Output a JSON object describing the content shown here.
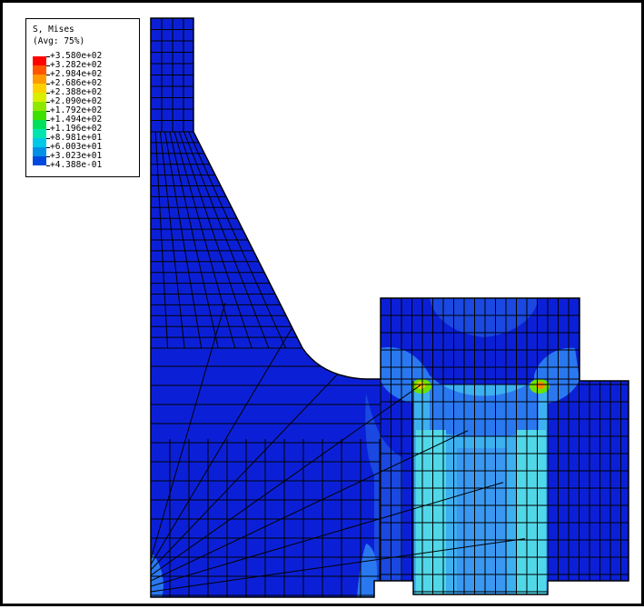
{
  "legend": {
    "variable": "S, Mises",
    "averaging": "(Avg: 75%)",
    "levels": [
      {
        "value": "+3.580e+02",
        "color": "#ff0000"
      },
      {
        "value": "+3.282e+02",
        "color": "#ff5500"
      },
      {
        "value": "+2.984e+02",
        "color": "#ff9a00"
      },
      {
        "value": "+2.686e+02",
        "color": "#ffd000"
      },
      {
        "value": "+2.388e+02",
        "color": "#d9ef00"
      },
      {
        "value": "+2.090e+02",
        "color": "#8fe800"
      },
      {
        "value": "+1.792e+02",
        "color": "#3ee000"
      },
      {
        "value": "+1.494e+02",
        "color": "#00e05a"
      },
      {
        "value": "+1.196e+02",
        "color": "#00e5b0"
      },
      {
        "value": "+8.981e+01",
        "color": "#00c8e8"
      },
      {
        "value": "+6.003e+01",
        "color": "#0090e8"
      },
      {
        "value": "+3.023e+01",
        "color": "#0048e0"
      },
      {
        "value": "+4.388e-01",
        "color": "#0010d8"
      }
    ]
  },
  "model": {
    "base_color": "#0b20d6",
    "mesh_line_color": "#000000",
    "hotspot_colors": [
      "#ffd000",
      "#6ee000",
      "#ff8c00"
    ],
    "mid_stress_colors": [
      "#3db0f0",
      "#50d8e8",
      "#2a78f0",
      "#1a48e0"
    ]
  }
}
